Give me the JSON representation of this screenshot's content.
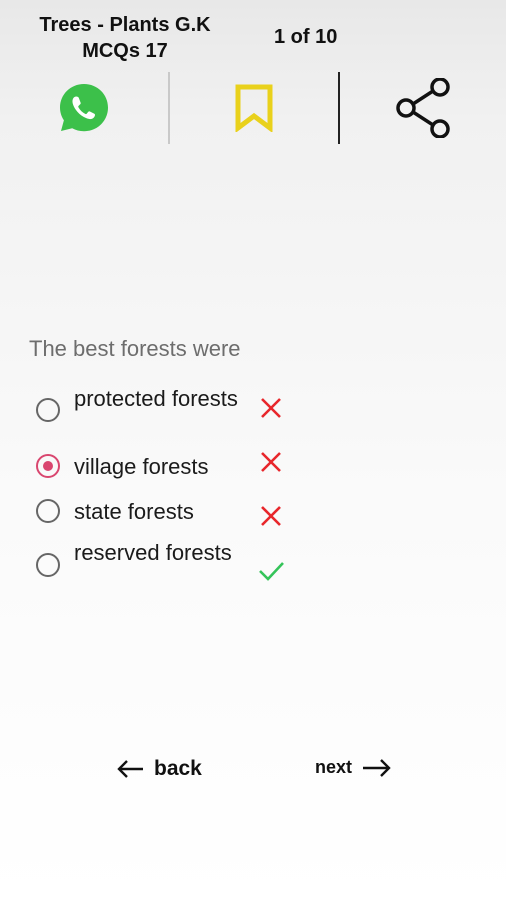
{
  "header": {
    "title": "Trees - Plants G.K MCQs 17",
    "counter": "1 of 10"
  },
  "actions": {
    "whatsapp_icon": "whatsapp-icon",
    "bookmark_icon": "bookmark-icon",
    "share_icon": "share-icon",
    "colors": {
      "whatsapp": "#3cc04a",
      "bookmark": "#e9d11b"
    }
  },
  "quiz": {
    "question": "The best forests were",
    "options": [
      {
        "label": "protected forests",
        "selected": false,
        "result": "wrong"
      },
      {
        "label": "village forests",
        "selected": true,
        "result": "wrong"
      },
      {
        "label": "state forests",
        "selected": false,
        "result": "wrong"
      },
      {
        "label": "reserved forests",
        "selected": false,
        "result": "correct"
      }
    ],
    "colors": {
      "wrong": "#e8262b",
      "correct": "#35c45a",
      "selected": "#d9466f"
    }
  },
  "nav": {
    "back_label": "back",
    "next_label": "next"
  }
}
